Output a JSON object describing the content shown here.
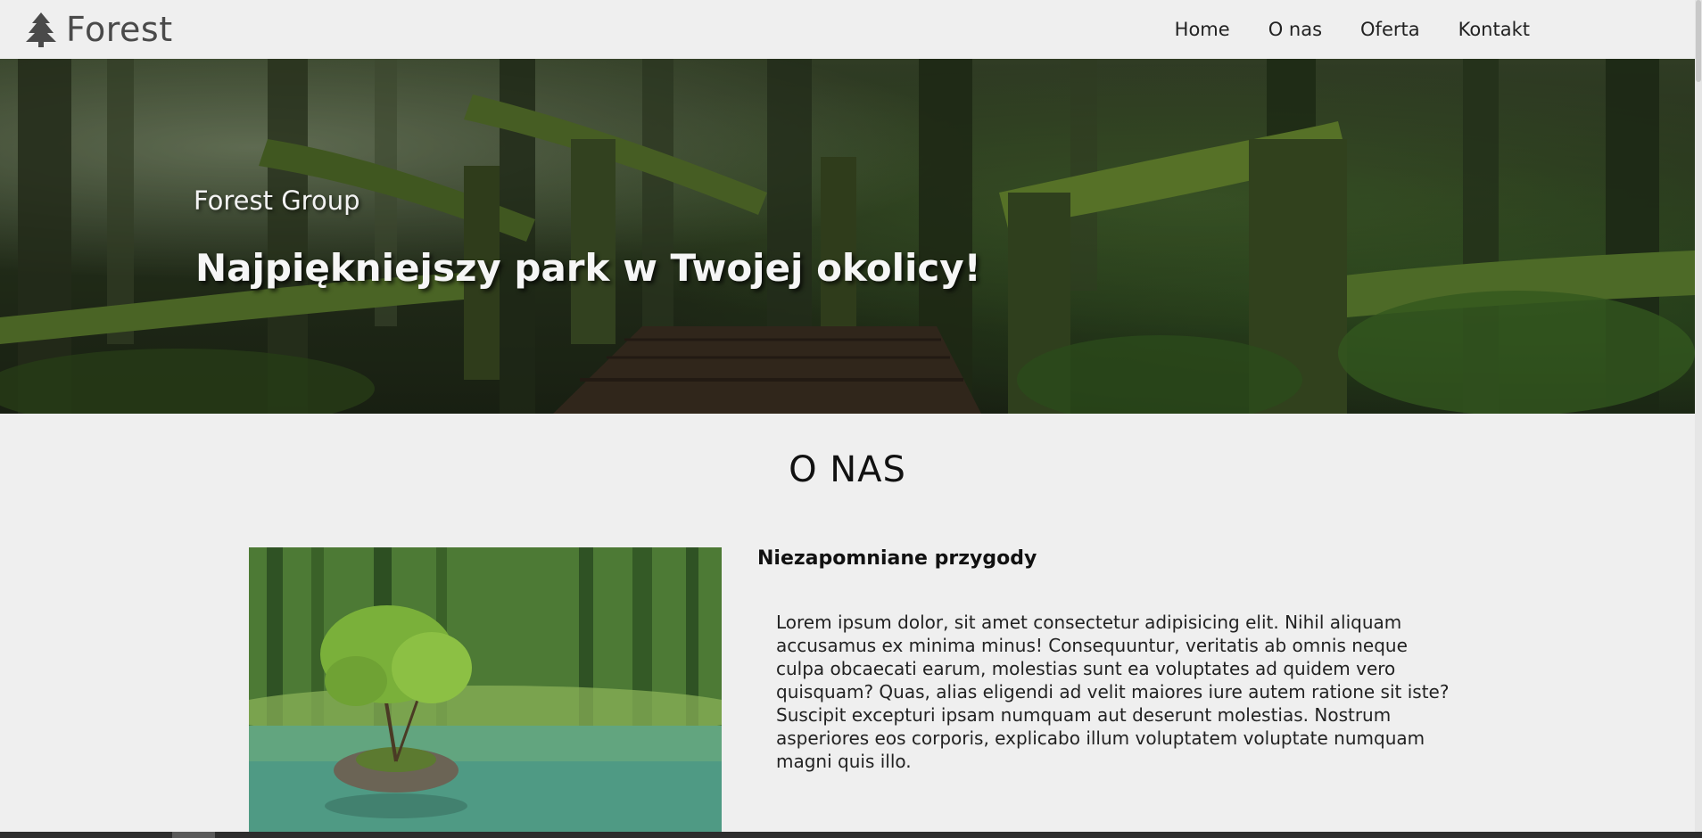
{
  "navbar": {
    "brand_icon": "tree-icon",
    "brand_label": "Forest",
    "links": [
      {
        "label": "Home"
      },
      {
        "label": "O nas"
      },
      {
        "label": "Oferta"
      },
      {
        "label": "Kontakt"
      }
    ]
  },
  "hero": {
    "subtitle": "Forest Group",
    "title": "Najpiękniejszy park w Twojej okolicy!"
  },
  "about": {
    "section_title": "O NAS",
    "heading": "Niezapomniane przygody",
    "text": "Lorem ipsum dolor, sit amet consectetur adipisicing elit. Nihil aliquam accusamus ex minima minus! Consequuntur, veritatis ab omnis neque culpa obcaecati earum, molestias sunt ea voluptates ad quidem vero quisquam? Quas, alias eligendi ad velit maiores iure autem ratione sit iste? Suscipit excepturi ipsam numquam aut deserunt molestias. Nostrum asperiores eos corporis, explicabo illum voluptatem voluptate numquam magni quis illo."
  },
  "colors": {
    "page_background": "#efefef",
    "brand_text": "#4a4a4a",
    "hero_text": "#f6f6f6"
  }
}
